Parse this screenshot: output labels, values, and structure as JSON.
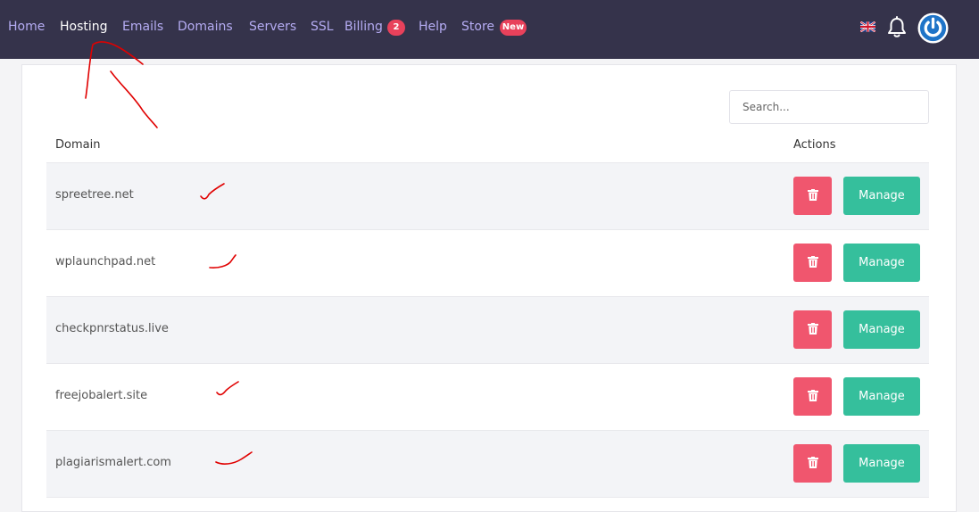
{
  "nav": {
    "items": [
      {
        "label": "Home",
        "active": false
      },
      {
        "label": "Hosting",
        "active": true
      },
      {
        "label": "Emails",
        "active": false
      },
      {
        "label": "Domains",
        "active": false
      },
      {
        "label": "Servers",
        "active": false
      },
      {
        "label": "SSL",
        "active": false
      },
      {
        "label": "Billing",
        "active": false,
        "badge": "2"
      },
      {
        "label": "Help",
        "active": false
      },
      {
        "label": "Store",
        "active": false,
        "badge": "New"
      }
    ],
    "language_icon": "uk-flag-icon",
    "notification_icon": "bell-icon",
    "profile_icon": "power-icon"
  },
  "search": {
    "placeholder": "Search..."
  },
  "table": {
    "columns": [
      "Domain",
      "Actions"
    ],
    "rows": [
      {
        "domain": "spreetree.net",
        "delete_icon": "trash-icon",
        "manage_label": "Manage"
      },
      {
        "domain": "wplaunchpad.net",
        "delete_icon": "trash-icon",
        "manage_label": "Manage"
      },
      {
        "domain": "checkpnrstatus.live",
        "delete_icon": "trash-icon",
        "manage_label": "Manage"
      },
      {
        "domain": "freejobalert.site",
        "delete_icon": "trash-icon",
        "manage_label": "Manage"
      },
      {
        "domain": "plagiarismalert.com",
        "delete_icon": "trash-icon",
        "manage_label": "Manage"
      }
    ]
  },
  "colors": {
    "navbar_bg": "#35334b",
    "nav_link": "#b5acf3",
    "badge": "#e8415b",
    "delete_button": "#f0566e",
    "manage_button": "#35bf9c",
    "annotation_ink": "#e00000"
  }
}
